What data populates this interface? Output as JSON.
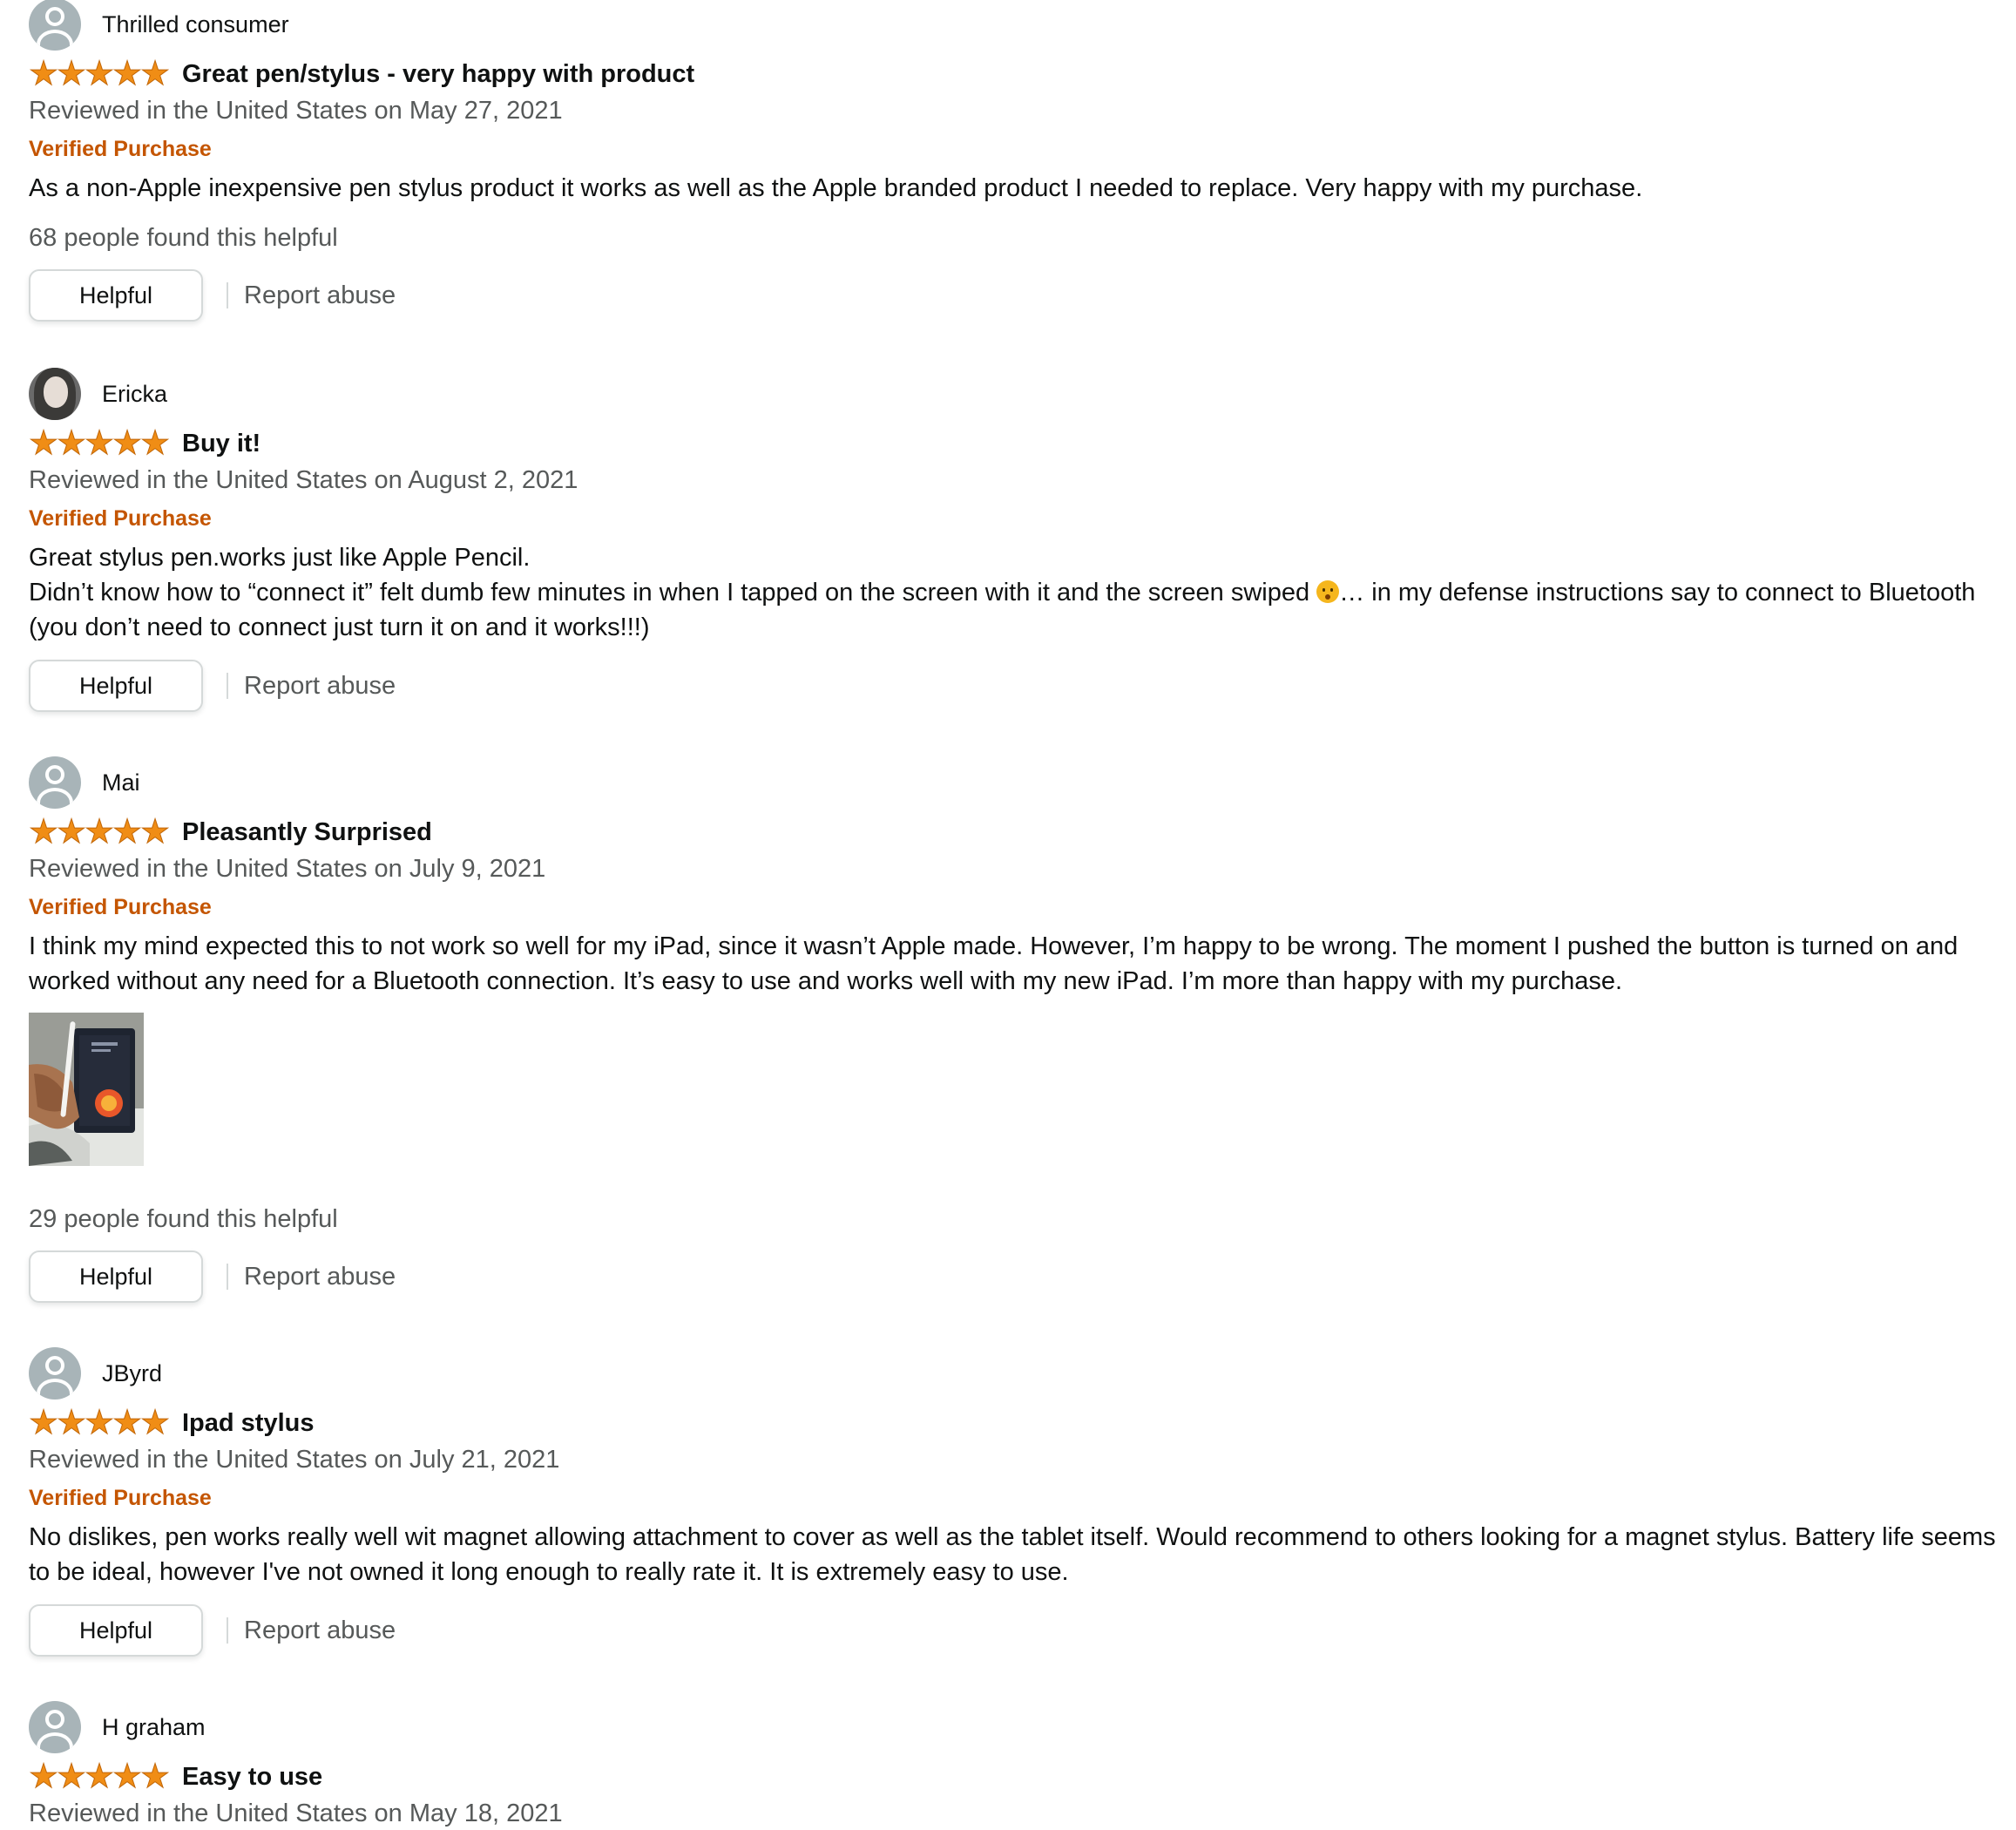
{
  "reviews": [
    {
      "author": "Thrilled consumer",
      "avatar": "default-avatar-icon",
      "rating": 5,
      "title": "Great pen/stylus - very happy with product",
      "date": "Reviewed in the United States on May 27, 2021",
      "verified": "Verified Purchase",
      "body": [
        "As a non-Apple inexpensive pen stylus product it works as well as the Apple branded product I needed to replace. Very happy with my purchase."
      ],
      "helpful_count": "68 people found this helpful",
      "helpful_label": "Helpful",
      "report_label": "Report abuse"
    },
    {
      "author": "Ericka",
      "avatar": "user-photo-avatar",
      "rating": 5,
      "title": "Buy it!",
      "date": "Reviewed in the United States on August 2, 2021",
      "verified": "Verified Purchase",
      "body": [
        "Great stylus pen.works just like Apple Pencil.",
        "Didn’t know how to “connect it” felt dumb few minutes in when I tapped on the screen with it and the screen swiped",
        "… in my defense instructions say to connect to Bluetooth (you don’t need to connect just turn it on and it works!!!)"
      ],
      "emoji": "face-with-open-mouth-emoji",
      "helpful_label": "Helpful",
      "report_label": "Report abuse"
    },
    {
      "author": "Mai",
      "avatar": "default-avatar-icon",
      "rating": 5,
      "title": "Pleasantly Surprised",
      "date": "Reviewed in the United States on July 9, 2021",
      "verified": "Verified Purchase",
      "body": [
        "I think my mind expected this to not work so well for my iPad, since it wasn’t Apple made. However, I’m happy to be wrong. The moment I pushed the button is turned on and worked without any need for a Bluetooth connection. It’s easy to use and works well with my new iPad. I’m more than happy with my purchase."
      ],
      "image": "customer-photo-stylus-ipad",
      "helpful_count": "29 people found this helpful",
      "helpful_label": "Helpful",
      "report_label": "Report abuse"
    },
    {
      "author": "JByrd",
      "avatar": "default-avatar-icon",
      "rating": 5,
      "title": "Ipad stylus",
      "date": "Reviewed in the United States on July 21, 2021",
      "verified": "Verified Purchase",
      "body": [
        "No dislikes, pen works really well wit magnet allowing attachment to cover as well as the tablet itself. Would recommend to others looking for a magnet stylus. Battery life seems to be ideal, however I've not owned it long enough to really rate it. It is extremely easy to use."
      ],
      "helpful_label": "Helpful",
      "report_label": "Report abuse"
    },
    {
      "author": "H graham",
      "avatar": "default-avatar-icon",
      "rating": 5,
      "title": "Easy to use",
      "date": "Reviewed in the United States on May 18, 2021"
    }
  ],
  "colors": {
    "star": "#f08d15",
    "verified": "#c45500",
    "muted_text": "#565959",
    "text": "#0f1111",
    "button_border": "#d5d9d9"
  }
}
